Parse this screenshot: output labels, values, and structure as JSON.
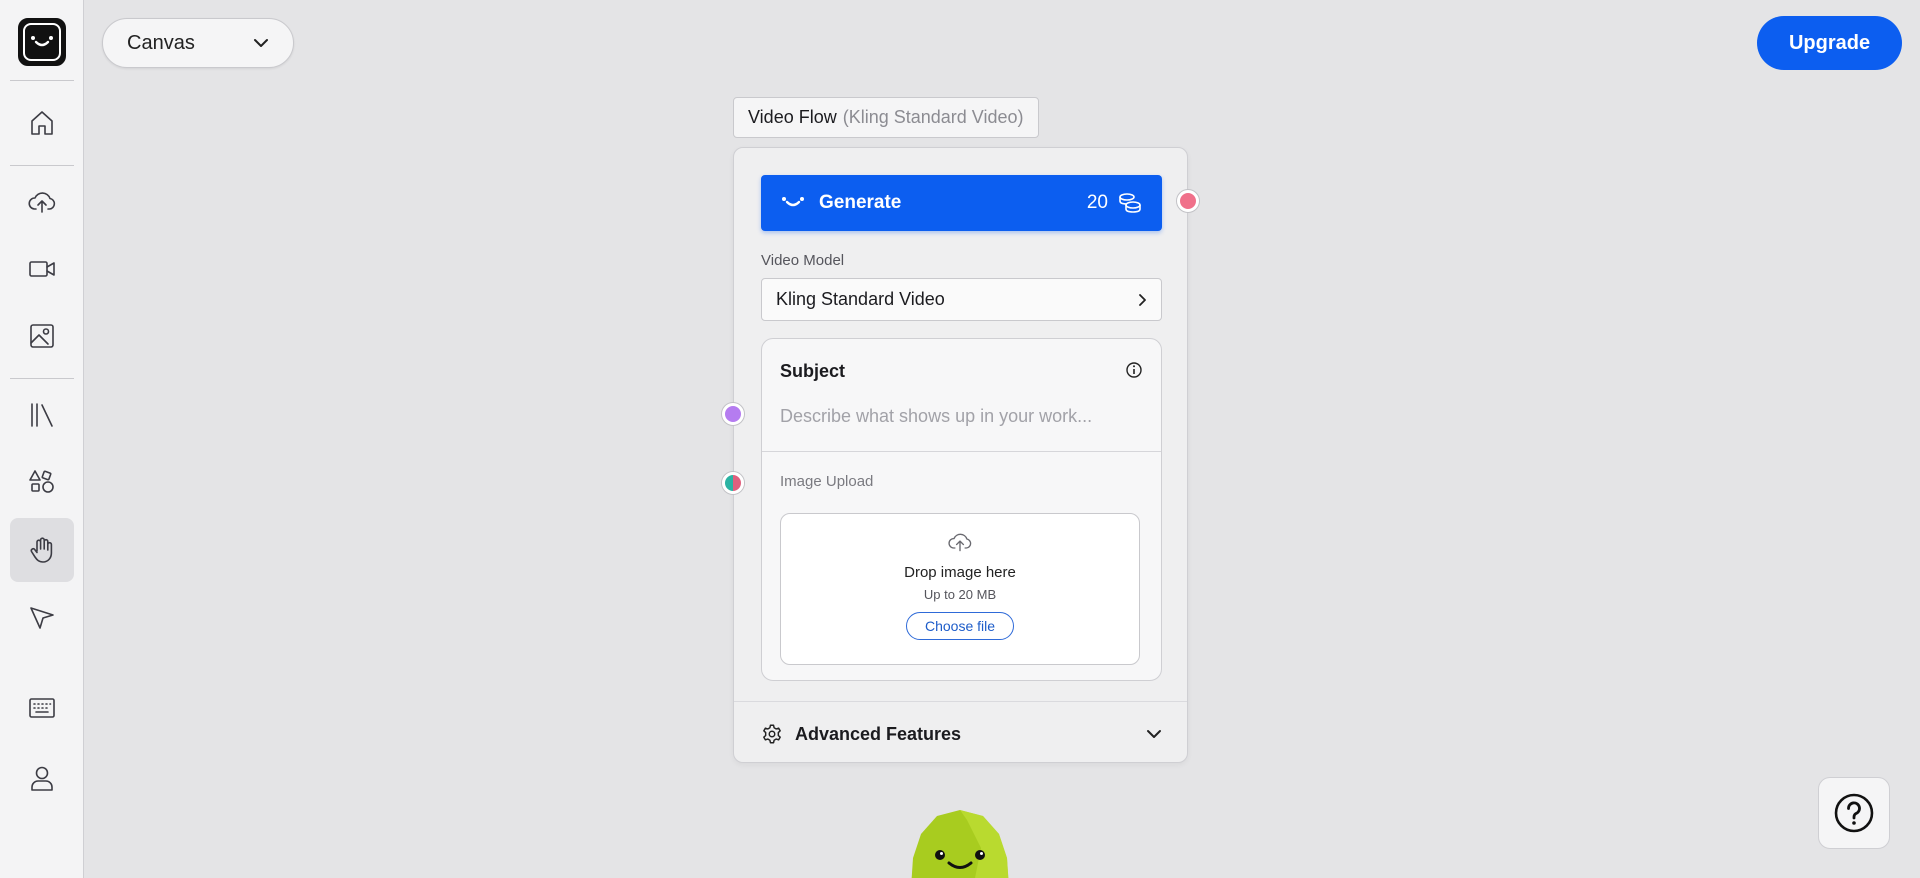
{
  "workspace": {
    "selector_label": "Canvas"
  },
  "header": {
    "upgrade_label": "Upgrade"
  },
  "sidebar": {
    "items": [
      {
        "name": "home-icon"
      },
      {
        "name": "upload-cloud-icon"
      },
      {
        "name": "video-icon"
      },
      {
        "name": "image-icon"
      },
      {
        "name": "library-icon"
      },
      {
        "name": "shapes-icon"
      },
      {
        "name": "hand-tool-icon",
        "active": true
      },
      {
        "name": "pointer-tool-icon"
      },
      {
        "name": "keyboard-icon"
      },
      {
        "name": "user-icon"
      }
    ]
  },
  "node": {
    "title": "Video Flow",
    "subtitle": "(Kling Standard Video)",
    "generate": {
      "label": "Generate",
      "cost": "20"
    },
    "video_model": {
      "label": "Video Model",
      "value": "Kling Standard Video"
    },
    "subject": {
      "label": "Subject",
      "placeholder": "Describe what shows up in your work..."
    },
    "image_upload": {
      "label": "Image Upload",
      "drop_title": "Drop image here",
      "drop_limit": "Up to 20 MB",
      "choose_label": "Choose file"
    },
    "advanced": {
      "label": "Advanced Features"
    }
  },
  "colors": {
    "accent": "#0c5ef0",
    "handle_output": "#f0708a",
    "handle_subject": "#b57cf0",
    "handle_image_a": "#2bb3a3",
    "handle_image_b": "#e0607e"
  }
}
